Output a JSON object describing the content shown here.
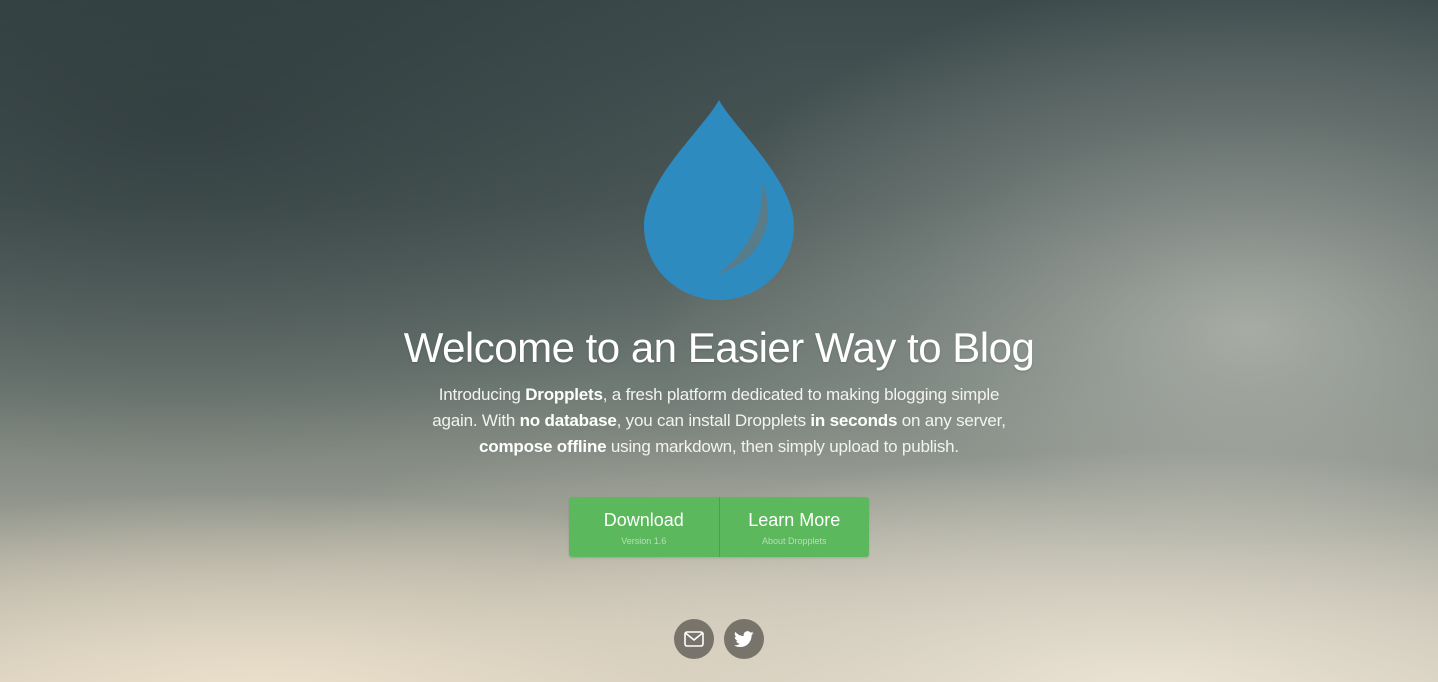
{
  "hero": {
    "logo_icon": "droplet-icon",
    "title": "Welcome to an Easier Way to Blog",
    "intro": {
      "p1": "Introducing ",
      "b1": "Dropplets",
      "p2": ", a fresh platform dedicated to making blogging simple again. With ",
      "b2": "no database",
      "p3": ", you can install Dropplets ",
      "b3": "in seconds",
      "p4": " on any server, ",
      "b4": "compose offline",
      "p5": " using markdown, then simply upload to publish."
    }
  },
  "buttons": {
    "download": {
      "label": "Download",
      "sub": "Version 1.6"
    },
    "learn_more": {
      "label": "Learn More",
      "sub": "About Dropplets"
    }
  },
  "social": {
    "email_icon": "envelope-icon",
    "twitter_icon": "twitter-bird-icon"
  },
  "colors": {
    "accent_green": "#5cb85c",
    "logo_blue": "#2e8bc0",
    "social_bg": "#69645c"
  }
}
